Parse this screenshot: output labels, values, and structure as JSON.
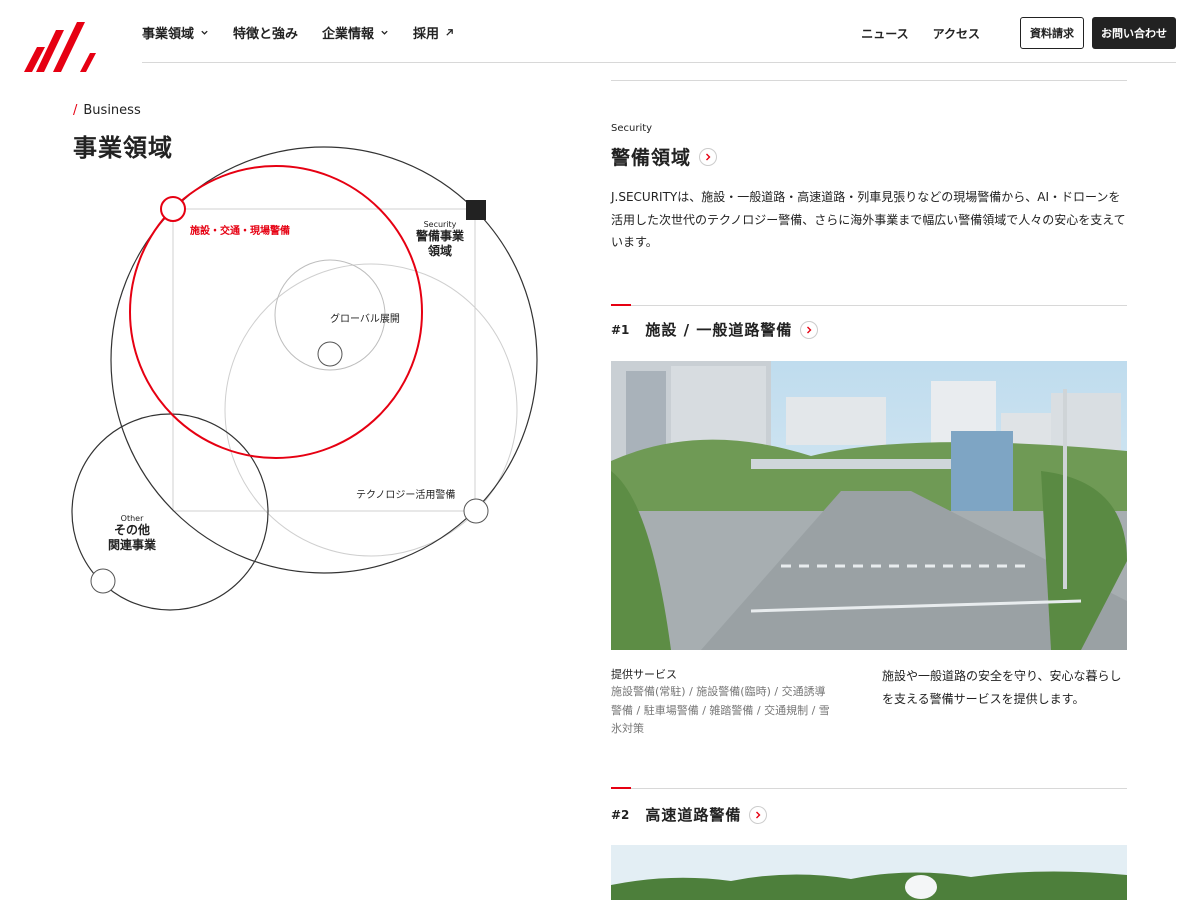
{
  "header": {
    "nav": [
      {
        "label": "事業領域",
        "has_dropdown": true
      },
      {
        "label": "特徴と強み",
        "has_dropdown": false
      },
      {
        "label": "企業情報",
        "has_dropdown": true
      },
      {
        "label": "採用",
        "external": true
      }
    ],
    "links": [
      "ニュース",
      "アクセス"
    ],
    "request_button": "資料請求",
    "contact_button": "お問い合わせ"
  },
  "business": {
    "eyebrow": "Business",
    "title": "事業領域",
    "diagram": {
      "facility_label": "施設・交通・現場警備",
      "security_eyebrow": "Security",
      "security_label": "警備事業\n領域",
      "global_label": "グローバル展開",
      "tech_label": "テクノロジー活用警備",
      "other_eyebrow": "Other",
      "other_label": "その他\n関連事業"
    }
  },
  "security": {
    "eyebrow": "Security",
    "title": "警備領域",
    "description": "J.SECURITYは、施設・一般道路・高速道路・列車見張りなどの現場警備から、AI・ドローンを活用した次世代のテクノロジー警備、さらに海外事業まで幅広い警備領域で人々の安心を支えています。",
    "items": [
      {
        "number": "#1",
        "title": "施設 / 一般道路警備",
        "services_label": "提供サービス",
        "services": "施設警備(常駐) / 施設警備(臨時) / 交通誘導警備 / 駐車場警備 / 雑踏警備 / 交通規制 / 雪氷対策",
        "description": "施設や一般道路の安全を守り、安心な暮らしを支える警備サービスを提供します。"
      },
      {
        "number": "#2",
        "title": "高速道路警備"
      }
    ]
  },
  "colors": {
    "accent": "#e60012",
    "text": "#222222",
    "rule": "#d8d8d8"
  }
}
